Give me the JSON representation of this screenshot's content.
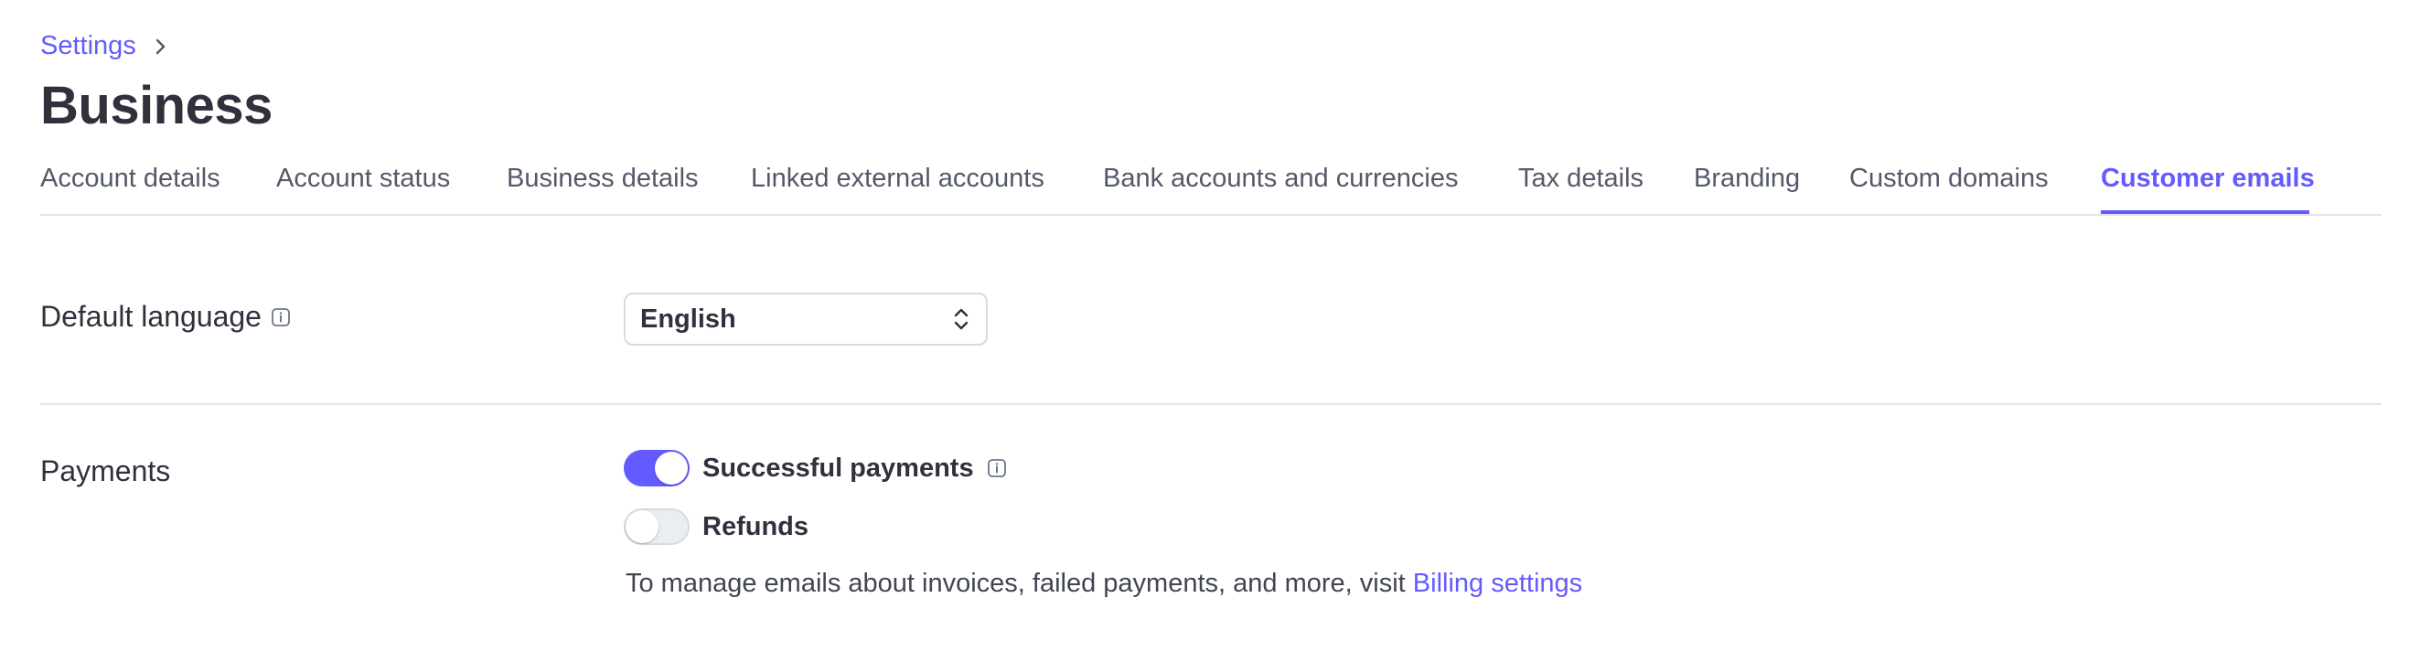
{
  "breadcrumb": {
    "parent": "Settings"
  },
  "page": {
    "title": "Business"
  },
  "tabs": [
    {
      "label": "Account details"
    },
    {
      "label": "Account status"
    },
    {
      "label": "Business details"
    },
    {
      "label": "Linked external accounts"
    },
    {
      "label": "Bank accounts and currencies"
    },
    {
      "label": "Tax details"
    },
    {
      "label": "Branding"
    },
    {
      "label": "Custom domains"
    },
    {
      "label": "Customer emails"
    }
  ],
  "active_tab": "Customer emails",
  "default_language": {
    "label": "Default language",
    "value": "English"
  },
  "payments": {
    "label": "Payments",
    "toggles": [
      {
        "label": "Successful payments",
        "on": true
      },
      {
        "label": "Refunds",
        "on": false
      }
    ],
    "note_text": "To manage emails about invoices, failed payments, and more, visit ",
    "note_link": "Billing settings"
  },
  "colors": {
    "accent": "#635bff",
    "text": "#30313d",
    "muted": "#545969",
    "border": "#e3e3e7"
  },
  "icons": {
    "breadcrumb_separator": "chevron-right-icon",
    "info": "info-icon",
    "select": "chevron-up-down-icon"
  }
}
